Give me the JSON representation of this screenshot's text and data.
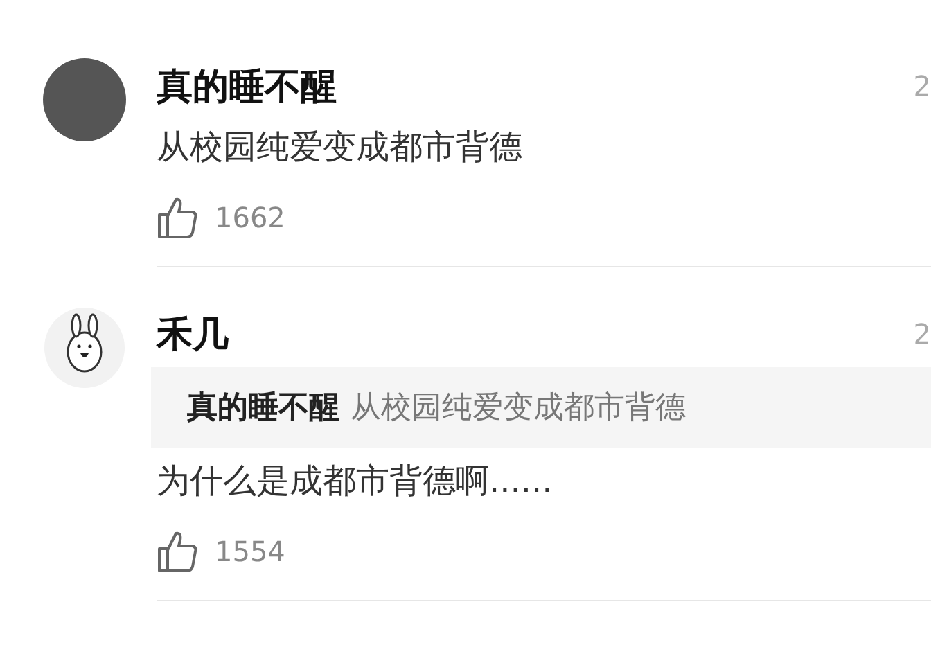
{
  "comments": [
    {
      "kind": "photo",
      "author": "真的睡不醒",
      "date": "2",
      "body": "从校园纯爱变成都市背德",
      "likes": "1662"
    },
    {
      "kind": "rabbit",
      "author": "禾几",
      "date": "2",
      "quote": {
        "author": "真的睡不醒",
        "text": "从校园纯爱变成都市背德"
      },
      "body": "为什么是成都市背德啊......",
      "likes": "1554"
    }
  ]
}
